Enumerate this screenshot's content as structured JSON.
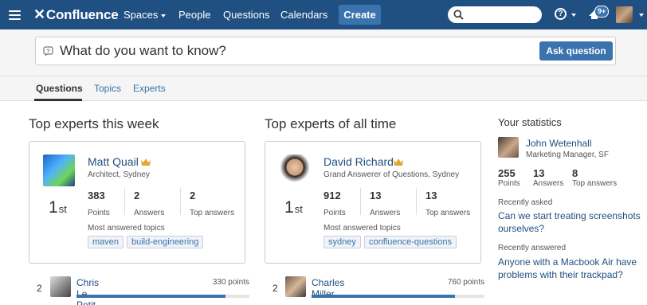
{
  "nav": {
    "logo": "Confluence",
    "links": [
      "Spaces",
      "People",
      "Questions",
      "Calendars"
    ],
    "create_label": "Create",
    "search_placeholder": "",
    "notification_badge": "9+"
  },
  "ask": {
    "placeholder": "What do you want to know?",
    "button_label": "Ask question"
  },
  "tabs": [
    "Questions",
    "Topics",
    "Experts"
  ],
  "week": {
    "title": "Top experts this week",
    "expert": {
      "name": "Matt Quail",
      "role": "Architect, Sydney",
      "rank_num": "1",
      "rank_suffix": "st",
      "points": "383",
      "points_label": "Points",
      "answers": "2",
      "answers_label": "Answers",
      "top_answers": "2",
      "top_answers_label": "Top answers",
      "topics_label": "Most answered topics",
      "topics": [
        "maven",
        "build-engineering"
      ]
    },
    "runner_up": {
      "rank": "2",
      "name": "Chris Le Petit",
      "points": "330 points",
      "fill": 0.86
    }
  },
  "alltime": {
    "title": "Top experts of all time",
    "expert": {
      "name": "David Richard",
      "role": "Grand Answerer of Questions, Sydney",
      "rank_num": "1",
      "rank_suffix": "st",
      "points": "912",
      "points_label": "Points",
      "answers": "13",
      "answers_label": "Answers",
      "top_answers": "13",
      "top_answers_label": "Top answers",
      "topics_label": "Most answered topics",
      "topics": [
        "sydney",
        "confluence-questions"
      ]
    },
    "runner_up": {
      "rank": "2",
      "name": "Charles Miller",
      "points": "760 points",
      "fill": 0.83
    }
  },
  "stats": {
    "title": "Your statistics",
    "name": "John Wetenhall",
    "role": "Marketing Manager, SF",
    "points": "255",
    "points_label": "Points",
    "answers": "13",
    "answers_label": "Answers",
    "top_answers": "8",
    "top_answers_label": "Top answers",
    "recently_asked_label": "Recently asked",
    "recently_asked": "Can we start treating screenshots ourselves?",
    "recently_answered_label": "Recently answered",
    "recently_answered": "Anyone with a Macbook Air have problems with their trackpad?"
  },
  "colors": {
    "nav_bg": "#205081",
    "accent": "#3b73af",
    "link": "#205081"
  }
}
